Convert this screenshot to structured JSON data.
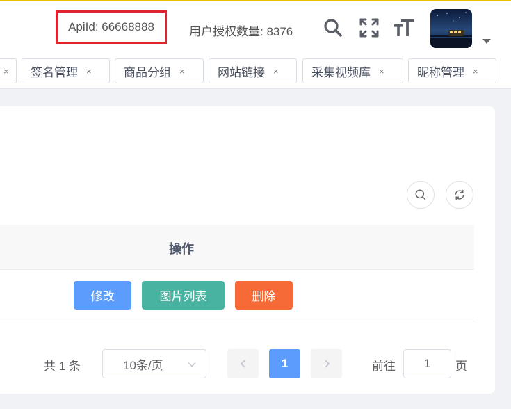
{
  "header": {
    "api_id": "ApiId: 66668888",
    "auth_count": "用户授权数量: 8376",
    "icons": [
      "search-icon",
      "fullscreen-icon",
      "font-size-icon",
      "avatar",
      "caret-down-icon"
    ]
  },
  "tags": [
    {
      "label": "签名管理",
      "close": "×"
    },
    {
      "label": "商品分组",
      "close": "×"
    },
    {
      "label": "网站链接",
      "close": "×"
    },
    {
      "label": "采集视频库",
      "close": "×"
    },
    {
      "label": "昵称管理",
      "close": "×"
    }
  ],
  "tag_partial_close": "×",
  "table": {
    "header_ops": "操作",
    "row": {
      "edit_label": "修改",
      "images_label": "图片列表",
      "delete_label": "删除"
    }
  },
  "pagination": {
    "total": "共 1 条",
    "page_size": "10条/页",
    "current_page": "1",
    "goto_label": "前往",
    "goto_value": "1",
    "page_suffix": "页"
  },
  "colors": {
    "primary": "#5b9cfc",
    "teal": "#48b3a0",
    "danger": "#f56a37",
    "highlight_border": "#e0242f"
  }
}
